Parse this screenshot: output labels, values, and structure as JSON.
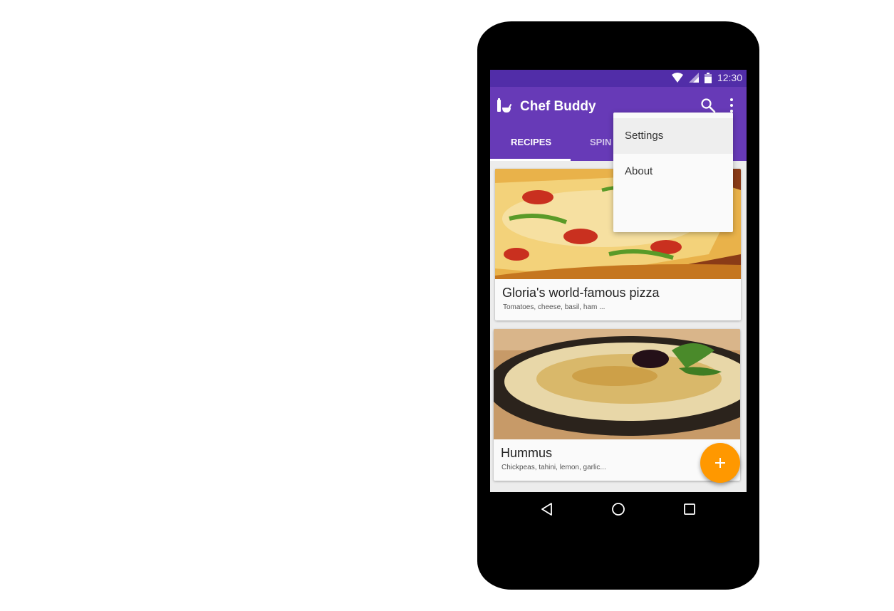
{
  "status_bar": {
    "time": "12:30",
    "icons": [
      "wifi-icon",
      "signal-icon",
      "battery-icon"
    ]
  },
  "app_bar": {
    "title": "Chef Buddy",
    "logo_icon": "chef-buddy-logo-icon",
    "actions": [
      "search-icon",
      "overflow-menu-icon"
    ]
  },
  "tabs": [
    {
      "label": "RECIPES",
      "active": true
    },
    {
      "label": "SPIN",
      "active": false
    }
  ],
  "recipes": [
    {
      "title": "Gloria's world-famous pizza",
      "ingredients": "Tomatoes, cheese, basil, ham ..."
    },
    {
      "title": "Hummus",
      "ingredients": "Chickpeas, tahini, lemon, garlic..."
    }
  ],
  "overflow_menu": {
    "items": [
      "Settings",
      "About"
    ]
  },
  "fab": {
    "icon": "plus-icon"
  },
  "nav_bar": {
    "icons": [
      "back-icon",
      "home-icon",
      "recents-icon"
    ]
  },
  "colors": {
    "primary": "#673ab7",
    "primary_dark": "#512da8",
    "accent": "#ff9800"
  }
}
